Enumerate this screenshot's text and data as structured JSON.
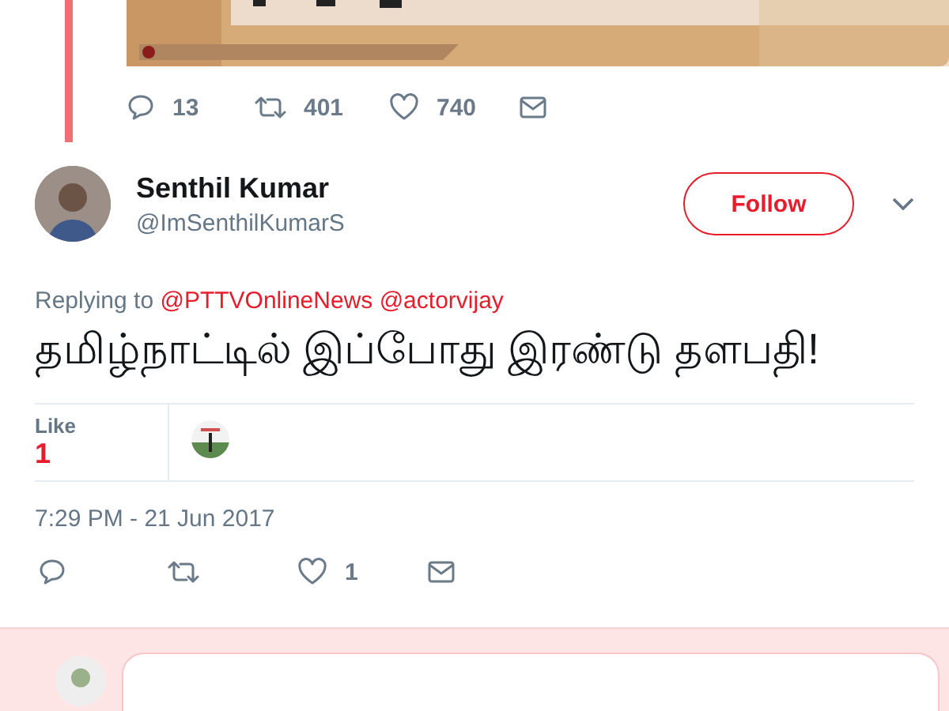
{
  "quoted_tweet": {
    "actions": [
      {
        "kind": "reply",
        "count": "13"
      },
      {
        "kind": "retweet",
        "count": "401"
      },
      {
        "kind": "like",
        "count": "740"
      },
      {
        "kind": "message"
      }
    ]
  },
  "tweet": {
    "author": {
      "name": "Senthil Kumar",
      "handle": "@ImSenthilKumarS"
    },
    "follow_button": "Follow",
    "replying_prefix": "Replying to",
    "replying_to": [
      "@PTTVOnlineNews",
      "@actorvijay"
    ],
    "text": "தமிழ்நாட்டில் இப்போது இரண்டு தளபதி!",
    "likes": {
      "label": "Like",
      "count": "1"
    },
    "timestamp": "7:29 PM - 21 Jun 2017",
    "actions": [
      {
        "kind": "reply"
      },
      {
        "kind": "retweet"
      },
      {
        "kind": "like",
        "count": "1"
      },
      {
        "kind": "message"
      }
    ]
  },
  "composer": {
    "kind": "reply-box"
  }
}
